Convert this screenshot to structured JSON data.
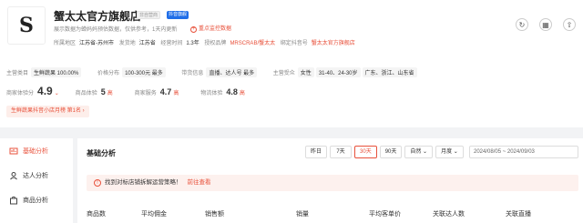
{
  "shop": {
    "logo_text": "S",
    "name": "蟹太太官方旗舰店",
    "tag_gray": "非自营商",
    "tag_blue": "抖音旗舰",
    "subtitle": "展示数据为蝉妈妈预估数据，仅供参考，1天内更新",
    "focus_label": "重点监控数据",
    "info": [
      {
        "k": "所属地区",
        "v": "江苏省-苏州市"
      },
      {
        "k": "发货地",
        "v": "江苏省"
      },
      {
        "k": "经营时间",
        "v": "1.3年"
      },
      {
        "k": "授权品牌",
        "v": "MRSCRAB/蟹太太",
        "red": true
      },
      {
        "k": "绑定抖音号",
        "v": "蟹太太官方旗舰店",
        "red": true
      }
    ]
  },
  "top_icons": [
    "refresh-icon",
    "qr-code-icon",
    "share-icon"
  ],
  "meta": {
    "main_category_k": "主营类目",
    "main_category_v": "生鲜蔬果 100.00%",
    "price_k": "价格分布",
    "price_v": "100-300元 最多",
    "buyer_k": "带货信息",
    "buyer_v": [
      "直播、达人号 最多"
    ],
    "audience_k": "主营受众",
    "audience_v": [
      "女性",
      "31-40、24-30岁",
      "广东、浙江、山东省"
    ]
  },
  "scores": {
    "shop_score_k": "商家体验分",
    "shop_score_v": "4.9",
    "product_k": "商品体验",
    "product_v": "5",
    "product_lvl": "高",
    "service_k": "商家服务",
    "service_v": "4.7",
    "service_lvl": "高",
    "logistics_k": "物流体验",
    "logistics_v": "4.8",
    "logistics_lvl": "高"
  },
  "rank_badge": "生鲜蔬果抖音小店月榜 第1名 ›",
  "sidebar": [
    {
      "label": "基础分析",
      "icon": "analysis-icon",
      "active": true
    },
    {
      "label": "达人分析",
      "icon": "user-icon",
      "active": false
    },
    {
      "label": "商品分析",
      "icon": "bag-icon",
      "active": false
    }
  ],
  "main": {
    "title": "基础分析",
    "ranges": [
      "昨日",
      "7天",
      "30天",
      "90天",
      "自然 ⌄",
      "月度 ⌄"
    ],
    "active_range": "30天",
    "date_range": "2024/08/05  ~  2024/09/03",
    "notice": "找到对标店铺拆解运营策略！",
    "notice_link": "前往查看",
    "columns": [
      "商品数",
      "平均佣金",
      "销售额",
      "销量",
      "平均客单价",
      "关联达人数",
      "关联直播"
    ]
  },
  "colors": {
    "accent": "#e8513b",
    "blue": "#1f6ee8"
  }
}
